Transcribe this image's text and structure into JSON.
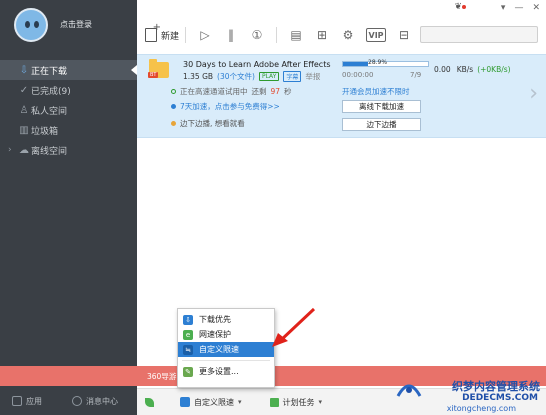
{
  "sidebar": {
    "login": "点击登录",
    "items": [
      {
        "label": "正在下载",
        "icon": "download-arrow-icon",
        "active": true
      },
      {
        "label": "已完成(9)",
        "icon": "check-circle-icon",
        "active": false
      },
      {
        "label": "私人空间",
        "icon": "person-icon",
        "active": false
      },
      {
        "label": "垃圾箱",
        "icon": "trash-icon",
        "active": false
      },
      {
        "label": "离线空间",
        "icon": "cloud-icon",
        "active": false
      }
    ],
    "bottom": {
      "apps": "应用",
      "messages": "消息中心"
    }
  },
  "toolbar": {
    "new_label": "新建",
    "vip_label": "VIP",
    "icons": [
      "play-icon",
      "pause-icon",
      "one-icon",
      "clipboard-icon",
      "grid-icon",
      "settings-icon",
      "vip-icon",
      "delete-icon"
    ]
  },
  "task": {
    "title": "30 Days to Learn Adobe After Effects",
    "size": "1.35 GB",
    "files": "(30个文件)",
    "tag_play": "PLAY",
    "tag_sub": "字幕",
    "tag_report": "举报",
    "progress_text": "28.9%",
    "progress": 0.289,
    "time_left": "00:00:00",
    "pieces": "7/9",
    "speed": "0.00",
    "speed_unit": "KB/s",
    "speed_plus": "(+0KB/s)",
    "accel_line1_a": "正在高速通道试用中",
    "accel_line1_b": "还剩",
    "accel_line1_c": "97",
    "accel_line1_d": "秒",
    "member_link": "开通会员加速不限时",
    "accel_line2": "7天加速，点击参与免费得>>",
    "btn_offline": "离线下载加速",
    "accel_line3": "边下边播, 想看就看",
    "btn_play": "边下边播"
  },
  "menu": {
    "items": [
      {
        "label": "下载优先",
        "icon": "download-priority-icon",
        "color": "#2d7fd3",
        "selected": false
      },
      {
        "label": "网速保护",
        "icon": "shield-icon",
        "color": "#4caf50",
        "selected": false
      },
      {
        "label": "自定义限速",
        "icon": "speed-limit-icon",
        "color": "#2d7fd3",
        "selected": true
      },
      {
        "label": "更多设置...",
        "icon": "wrench-icon",
        "color": "#6aa84f",
        "selected": false
      }
    ]
  },
  "status": {
    "promo": "360导游",
    "limit_label": "自定义限速",
    "plan_label": "计划任务"
  },
  "watermark": {
    "title": "织梦内容管理系统",
    "site": "DEDECMS.COM",
    "url": "xitongcheng.com"
  },
  "colors": {
    "accent": "#2d7fd3",
    "sidebar": "#3a3f45",
    "task_bg": "#d9ecfa",
    "promo": "#e8726a"
  }
}
